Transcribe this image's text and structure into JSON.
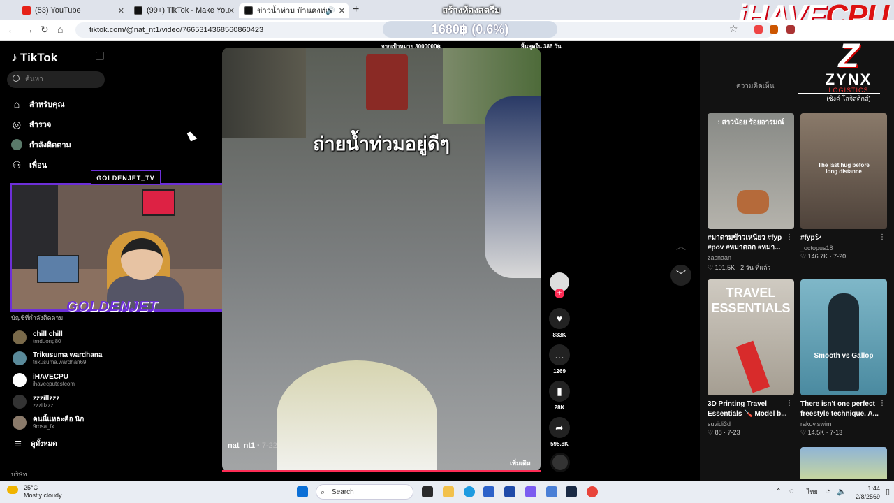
{
  "browser": {
    "tabs": [
      {
        "title": "(53) YouTube",
        "color": "#e62117"
      },
      {
        "title": "(99+) TikTok - Make Your Day",
        "color": "#111111"
      },
      {
        "title": "ข่าวน้ำท่วม บ้านคงท่อย ล่าสุด",
        "color": "#111111"
      }
    ],
    "url": "tiktok.com/@nat_nt1/video/7665314368560860423",
    "stream_title": "สร้างห้องสตรีม",
    "donation": "1680฿ (0.6%)",
    "brand_watermark_a": "iHAVE",
    "brand_watermark_b": "CPU"
  },
  "sidebar": {
    "logo": "TikTok",
    "search_placeholder": "ค้นหา",
    "nav": [
      {
        "label": "สำหรับคุณ",
        "icon": "home-icon"
      },
      {
        "label": "สำรวจ",
        "icon": "compass-icon"
      },
      {
        "label": "กำลังติดตาม",
        "icon": "following-avatar-icon"
      },
      {
        "label": "เพื่อน",
        "icon": "friends-icon"
      }
    ],
    "following_header": "บัญชีที่กำลังติดตาม",
    "following": [
      {
        "name": "chill chill",
        "handle": "trnduong80",
        "color": "#7a6a4a"
      },
      {
        "name": "Trikusuma wardhana",
        "handle": "trikusuma.wardhan69",
        "color": "#5a8a9a"
      },
      {
        "name": "iHAVECPU",
        "handle": "ihavecputestcom",
        "color": "#ffffff"
      },
      {
        "name": "zzzillzzz",
        "handle": "zzzillzzz",
        "color": "#333333"
      },
      {
        "name": "คนนี้แหละคือ นิก",
        "handle": "9rosa_fx",
        "color": "#8a7a6a"
      }
    ],
    "see_all": "ดูทั้งหมด",
    "company": "บริษัท"
  },
  "webcam": {
    "name_tag": "GOLDENJET_TV",
    "brand": "GOLDENJET"
  },
  "video": {
    "caption": "ถ่ายน้ำท่วมอยู่ดีๆ",
    "overlay_left": "จากเป้าหมาย 3000000฿",
    "overlay_right": "สิ้นสุดใน 386 วัน",
    "author": "nat_nt1",
    "date": "7-22",
    "more": "เพิ่มเติม",
    "likes": "833K",
    "comments": "1269",
    "saves": "28K",
    "shares": "595.8K"
  },
  "right_panel": {
    "tab_comments": "ความคิดเห็น",
    "sponsor": {
      "logo": "Z",
      "name": "ZYNX",
      "sub": "LOGISTICS",
      "thai": "(ซิงค์ โลจิสติกส์)"
    },
    "cards": [
      {
        "title": "#มาดามข้าวเหนียว #fyp #pov #หมาตลก #หมา...",
        "user": "zasnaan",
        "likes": "101.5K",
        "age": "2 วัน ที่แล้ว",
        "overlay": ": สาวน้อย ร้อยอารมณ์",
        "bg": "#9a9a94"
      },
      {
        "title": "#fypシ",
        "user": "_octopus18",
        "likes": "146.7K",
        "age": "7-20",
        "overlay": "The last hug before long distance",
        "bg": "#6a5a4e"
      },
      {
        "title": "3D Printing Travel Essentials 🪛 Model b...",
        "user": "suvidi3d",
        "likes": "88",
        "age": "7-23",
        "overlay": "TRAVEL ESSENTIALS",
        "bg": "#c9c4bb"
      },
      {
        "title": "There isn't one perfect freestyle technique. A...",
        "user": "rakov.swim",
        "likes": "14.5K",
        "age": "7-13",
        "overlay": "Smooth vs Gallop",
        "bg": "#6fa6b8"
      }
    ]
  },
  "taskbar": {
    "temperature": "25°C",
    "weather": "Mostly cloudy",
    "search": "Search",
    "lang": "ไทย",
    "time": "1:44",
    "date": "2/8/2569"
  }
}
